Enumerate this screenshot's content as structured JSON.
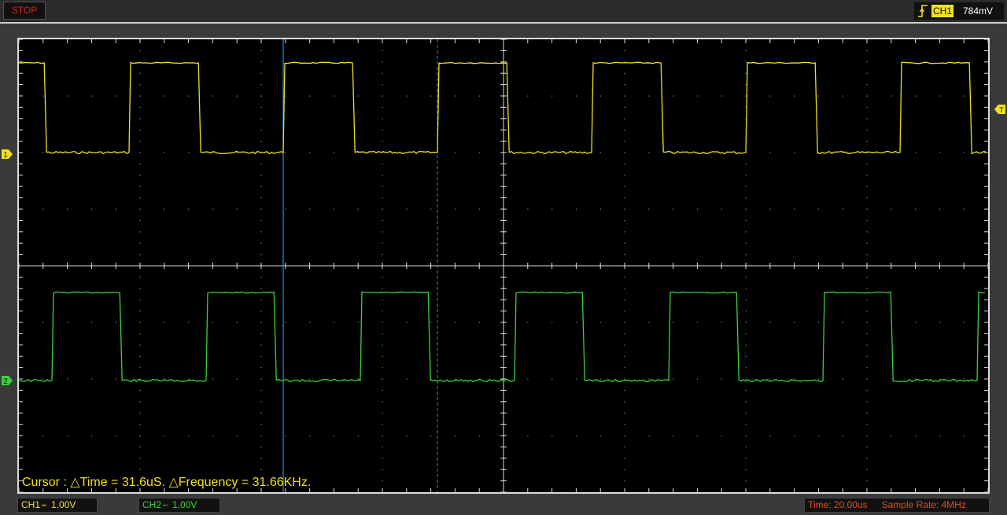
{
  "toolbar": {
    "run_state": "STOP",
    "trigger": {
      "icon": "rising-edge-trigger-icon",
      "channel": "CH1",
      "level": "784mV"
    }
  },
  "display": {
    "cursor_readout": "Cursor : △Time = 31.6uS. △Frequency = 31.66KHz.",
    "grid_divisions": {
      "horizontal": 8,
      "vertical": 8
    },
    "ch1_marker": "1",
    "ch2_marker": "2",
    "trigger_marker": "T"
  },
  "status_bar": {
    "ch1": {
      "label": "CH1",
      "coupling": "┉",
      "scale": "1.00V"
    },
    "ch2": {
      "label": "CH2",
      "coupling": "┉",
      "scale": "1.00V"
    },
    "time_base": "Time: 20.00us",
    "sample_rate": "Sample Rate: 4MHz"
  },
  "colors": {
    "ch1": "#f0e020",
    "ch2": "#3ad23a",
    "cursor": "#2a8ee0",
    "stop": "#e0201a",
    "grid": "#dcdcdc",
    "status_right": "#e04d22"
  }
}
